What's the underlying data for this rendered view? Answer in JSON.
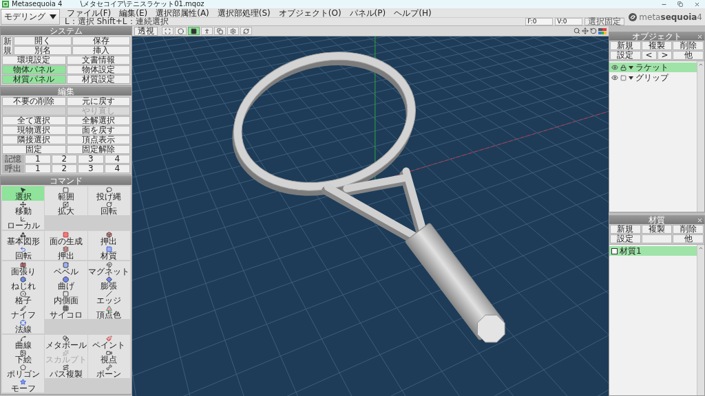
{
  "window": {
    "app_title": "Metasequoia 4",
    "file_path": "\\メタセコイア\\テニスラケット01.mqoz"
  },
  "mode_selector": {
    "value": "モデリング"
  },
  "menu": [
    "ファイル(F)",
    "編集(E)",
    "選択部属性(A)",
    "選択部処理(S)",
    "オブジェクト(O)",
    "パネル(P)",
    "ヘルプ(H)"
  ],
  "status_hint": "L：選択 Shift+L：連続選択",
  "counters": {
    "faces": "F:0",
    "vertices": "V:0"
  },
  "selection_lock": {
    "label": "選択固定",
    "on": false
  },
  "logo": "meta**sequoia**4",
  "system_panel": {
    "title": "システム",
    "new_button": "新規",
    "file_buttons": [
      "開く",
      "保存",
      "別名",
      "挿入"
    ],
    "settings_buttons": [
      {
        "label": "環境設定",
        "on": false
      },
      {
        "label": "文書情報",
        "on": false
      },
      {
        "label": "物体パネル",
        "on": true
      },
      {
        "label": "物体設定",
        "on": false
      },
      {
        "label": "材質パネル",
        "on": true
      },
      {
        "label": "材質設定",
        "on": false
      }
    ]
  },
  "edit_panel": {
    "title": "編集",
    "items": [
      {
        "kind": "button",
        "label": "不要の削除",
        "disabled": false
      },
      {
        "kind": "button",
        "label": "元に戻す",
        "disabled": false
      },
      {
        "kind": "blank",
        "disabled": true
      },
      {
        "kind": "button",
        "label": "やり直し",
        "disabled": true
      },
      {
        "kind": "button",
        "label": "全て選択",
        "disabled": false
      },
      {
        "kind": "button",
        "label": "全解選択",
        "disabled": false
      },
      {
        "kind": "button",
        "label": "現物選択",
        "disabled": false
      },
      {
        "kind": "button",
        "label": "面を戻す",
        "disabled": false
      },
      {
        "kind": "button",
        "label": "隣接選択",
        "disabled": false
      },
      {
        "kind": "button",
        "label": "頂点表示",
        "disabled": false
      },
      {
        "kind": "button",
        "label": "固定",
        "disabled": false
      },
      {
        "kind": "button",
        "label": "固定解除",
        "disabled": false
      }
    ],
    "memory_rows": [
      {
        "label": "記憶",
        "slots": [
          "1",
          "2",
          "3",
          "4"
        ]
      },
      {
        "label": "呼出",
        "slots": [
          "1",
          "2",
          "3",
          "4"
        ]
      }
    ]
  },
  "command_panel": {
    "title": "コマンド",
    "groups": [
      {
        "tools": [
          {
            "label": "選択",
            "selected": true,
            "disabled": false
          },
          {
            "label": "範囲",
            "selected": false,
            "disabled": false
          },
          {
            "label": "投げ縄",
            "selected": false,
            "disabled": false
          },
          {
            "label": "移動",
            "selected": false,
            "disabled": false
          },
          {
            "label": "拡大",
            "selected": false,
            "disabled": false
          },
          {
            "label": "回転",
            "selected": false,
            "disabled": false
          },
          {
            "label": "ローカル",
            "selected": false,
            "disabled": false
          }
        ]
      },
      {
        "tools": [
          {
            "label": "基本図形",
            "selected": false,
            "disabled": false
          },
          {
            "label": "面の生成",
            "selected": false,
            "disabled": false
          },
          {
            "label": "押出",
            "selected": false,
            "disabled": false
          },
          {
            "label": "回転",
            "selected": false,
            "disabled": false
          },
          {
            "label": "押出",
            "selected": false,
            "disabled": false
          },
          {
            "label": "材質",
            "selected": false,
            "disabled": false
          }
        ]
      },
      {
        "tools": [
          {
            "label": "面張り",
            "selected": false,
            "disabled": false
          },
          {
            "label": "ベベル",
            "selected": false,
            "disabled": false
          },
          {
            "label": "マグネット",
            "selected": false,
            "disabled": false
          },
          {
            "label": "ねじれ",
            "selected": false,
            "disabled": false
          },
          {
            "label": "曲げ",
            "selected": false,
            "disabled": false
          },
          {
            "label": "膨張",
            "selected": false,
            "disabled": false
          },
          {
            "label": "格子",
            "selected": false,
            "disabled": false
          },
          {
            "label": "内側面",
            "selected": false,
            "disabled": false
          },
          {
            "label": "エッジ",
            "selected": false,
            "disabled": false
          },
          {
            "label": "ナイフ",
            "selected": false,
            "disabled": false
          },
          {
            "label": "サイコロ",
            "selected": false,
            "disabled": false
          },
          {
            "label": "頂点色",
            "selected": false,
            "disabled": false
          },
          {
            "label": "法線",
            "selected": false,
            "disabled": false
          }
        ]
      },
      {
        "tools": [
          {
            "label": "曲線",
            "selected": false,
            "disabled": false
          },
          {
            "label": "メタボール",
            "selected": false,
            "disabled": false
          },
          {
            "label": "ペイント",
            "selected": false,
            "disabled": false
          },
          {
            "label": "下絵",
            "selected": false,
            "disabled": false
          },
          {
            "label": "スカルプト",
            "selected": false,
            "disabled": true
          },
          {
            "label": "視点",
            "selected": false,
            "disabled": false
          },
          {
            "label": "ポリゴン",
            "selected": false,
            "disabled": false
          },
          {
            "label": "パス複製",
            "selected": false,
            "disabled": false
          },
          {
            "label": "ボーン",
            "selected": false,
            "disabled": false
          },
          {
            "label": "モーフ",
            "selected": false,
            "disabled": false
          }
        ]
      }
    ]
  },
  "viewport_toolbar": {
    "projection": "透視",
    "tools": [
      {
        "selected": false
      },
      {
        "selected": false
      },
      {
        "selected": true
      },
      {
        "selected": false
      },
      {
        "selected": false
      },
      {
        "selected": false
      },
      {
        "selected": false
      }
    ]
  },
  "object_panel": {
    "title": "オブジェクト",
    "buttons": [
      "新規",
      "複製",
      "削除"
    ],
    "nav_buttons": [
      "設定",
      "<",
      ">",
      "他"
    ],
    "objects": [
      {
        "name": "ラケット",
        "visible": true,
        "locked": true,
        "selected": true
      },
      {
        "name": "グリップ",
        "visible": true,
        "locked": false,
        "selected": false
      }
    ]
  },
  "material_panel": {
    "title": "材質",
    "buttons": [
      "新規",
      "複製",
      "削除"
    ],
    "nav_buttons": [
      "設定",
      "他"
    ],
    "materials": [
      {
        "name": "材質1",
        "color": "#ffffff",
        "selected": true
      }
    ]
  }
}
